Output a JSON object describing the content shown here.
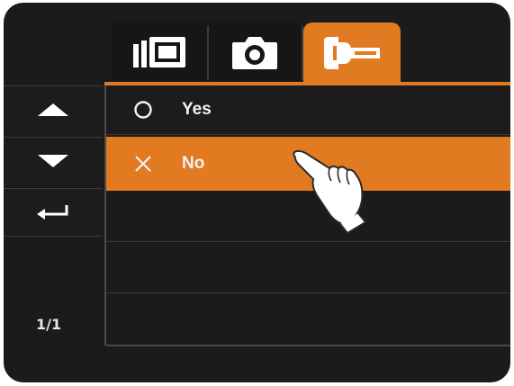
{
  "tabs": [
    {
      "id": "video",
      "icon": "video-mode-icon",
      "active": false
    },
    {
      "id": "photo",
      "icon": "camera-icon",
      "active": false
    },
    {
      "id": "setup",
      "icon": "wrench-icon",
      "active": true
    }
  ],
  "nav": {
    "up_icon": "up-arrow-icon",
    "down_icon": "down-arrow-icon",
    "enter_icon": "enter-return-icon",
    "page_indicator": "1/1"
  },
  "options": [
    {
      "icon": "circle-icon",
      "label": "Yes",
      "selected": false
    },
    {
      "icon": "cross-icon",
      "label": "No",
      "selected": true
    }
  ],
  "colors": {
    "accent": "#e27a21",
    "background": "#1b1b1b",
    "text": "#f2f2f2"
  }
}
